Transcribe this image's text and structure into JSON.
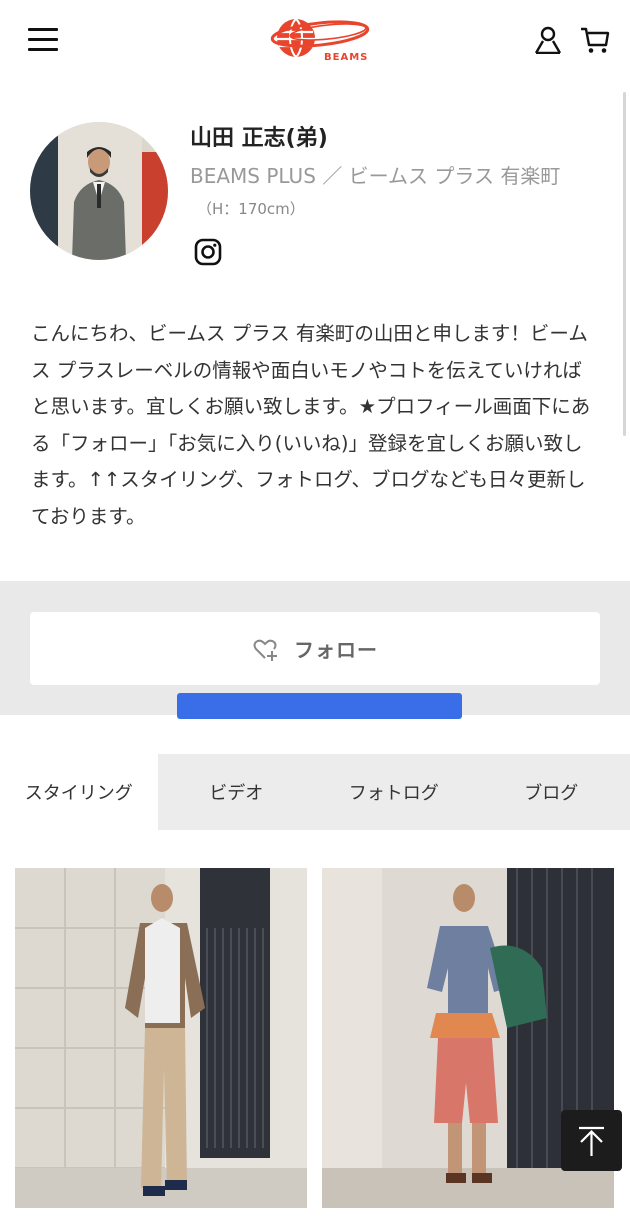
{
  "header": {
    "logo_text": "BEAMS",
    "brand_color": "#e8452c",
    "icons": [
      "hamburger-menu-icon",
      "user-icon",
      "cart-icon"
    ]
  },
  "profile": {
    "name": "山田 正志(弟)",
    "shop": "BEAMS PLUS ／ ビームス プラス 有楽町",
    "height": "（H：170cm）",
    "social_icon": "instagram-icon"
  },
  "bio": "こんにちわ、ビームス プラス 有楽町の山田と申します！ビームス プラスレーベルの情報や面白いモノやコトを伝えていければと思います。宜しくお願い致します。★プロフィール画面下にある「フォロー」「お気に入り(いいね)」登録を宜しくお願い致します。↑↑スタイリング、フォトログ、ブログなども日々更新しております。",
  "follow": {
    "label": "フォロー",
    "icon": "heart-plus-icon"
  },
  "highlight_color": "#3a6de8",
  "tabs": [
    {
      "label": "スタイリング",
      "active": true
    },
    {
      "label": "ビデオ",
      "active": false
    },
    {
      "label": "フォトログ",
      "active": false
    },
    {
      "label": "ブログ",
      "active": false
    }
  ],
  "photos": [
    "styling-photo-1",
    "styling-photo-2"
  ],
  "back_to_top_icon": "arrow-up-icon"
}
